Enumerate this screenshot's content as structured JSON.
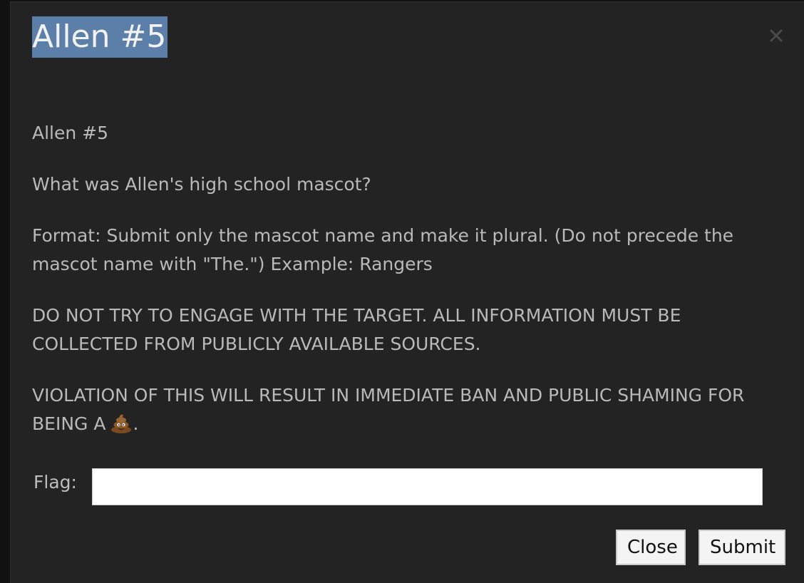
{
  "modal": {
    "title": "Allen #5",
    "close_icon": "close-icon",
    "body": {
      "name": "Allen #5",
      "question": "What was Allen's high school mascot?",
      "format_line1": "Format: Submit only the mascot name and make it plural. (Do not precede the",
      "format_line2": "mascot name with \"The.\") Example: Rangers",
      "warning_line1": "DO NOT TRY TO ENGAGE WITH THE TARGET. ALL INFORMATION MUST BE",
      "warning_line2": "COLLECTED FROM PUBLICLY AVAILABLE SOURCES.",
      "violation_line1": "VIOLATION OF THIS WILL RESULT IN IMMEDIATE BAN AND PUBLIC SHAMING FOR",
      "violation_line2_prefix": "BEING A",
      "violation_icon": "pile-of-poo-icon",
      "violation_line2_suffix": "."
    },
    "flag": {
      "label": "Flag:",
      "value": "",
      "placeholder": ""
    },
    "buttons": {
      "close_label": "Close",
      "submit_label": "Submit"
    }
  },
  "colors": {
    "modal_background": "#232323",
    "title_highlight": "#5b7fa8",
    "body_text": "#b9b9b9"
  }
}
